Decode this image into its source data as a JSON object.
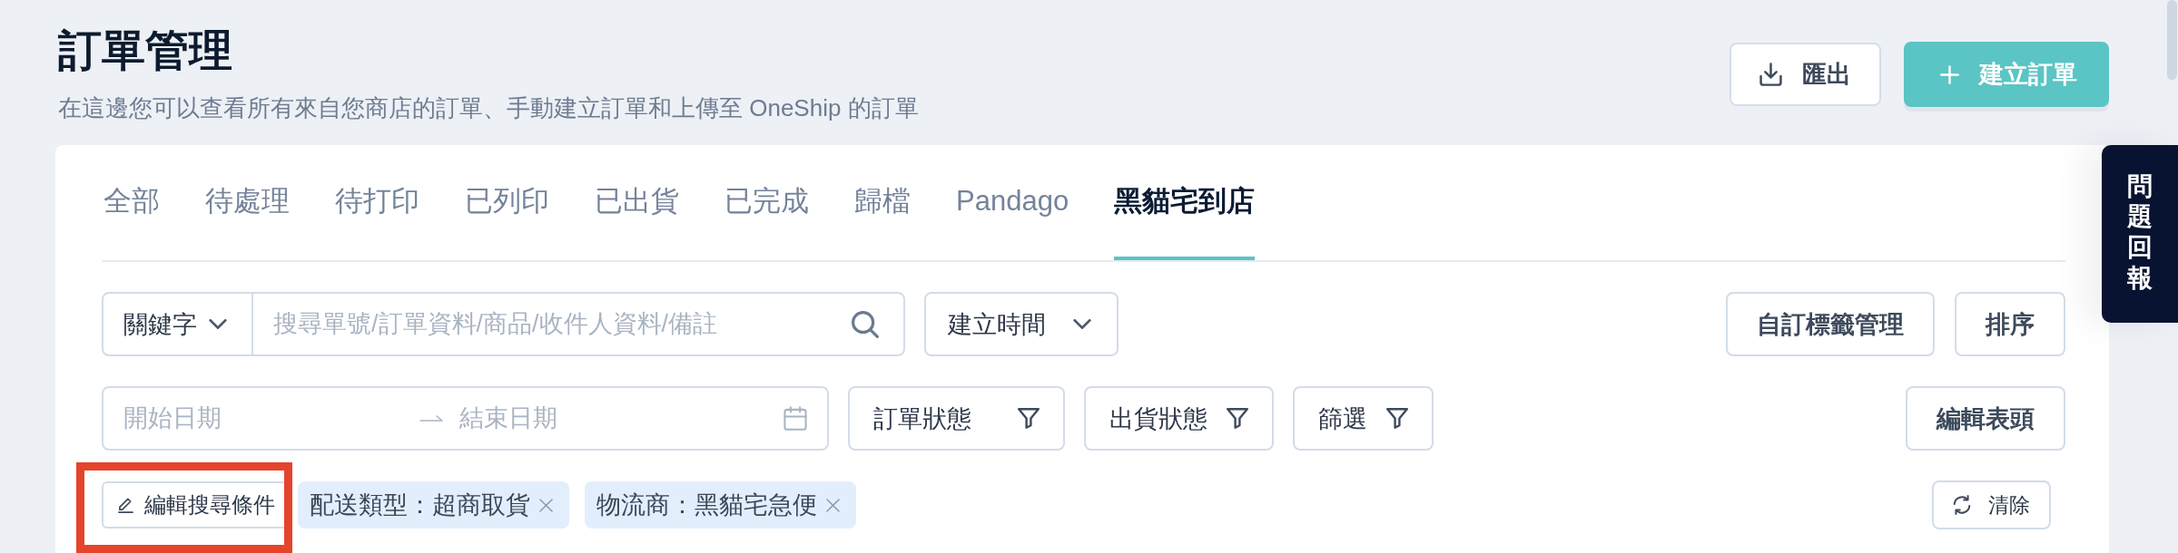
{
  "page": {
    "title": "訂單管理",
    "subtitle": "在這邊您可以查看所有來自您商店的訂單、手動建立訂單和上傳至 OneShip 的訂單"
  },
  "header_actions": [
    {
      "kind": "secondary",
      "label": "匯出"
    },
    {
      "kind": "primary",
      "label": "建立訂單"
    }
  ],
  "feedback_tab": {
    "label": "問題回報"
  },
  "tabs": [
    {
      "label": "全部",
      "selected": false
    },
    {
      "label": "待處理",
      "selected": false
    },
    {
      "label": "待打印",
      "selected": false
    },
    {
      "label": "已列印",
      "selected": false
    },
    {
      "label": "已出貨",
      "selected": false
    },
    {
      "label": "已完成",
      "selected": false
    },
    {
      "label": "歸檔",
      "selected": false
    },
    {
      "label": "Pandago",
      "selected": false
    },
    {
      "label": "黑貓宅到店",
      "selected": true
    }
  ],
  "search": {
    "field_select": "關鍵字",
    "placeholder": "搜尋單號/訂單資料/商品/收件人資料/備註"
  },
  "time_select": "建立時間",
  "toolbar_buttons": [
    "自訂標籤管理",
    "排序"
  ],
  "date_range": {
    "start_placeholder": "開始日期",
    "end_placeholder": "結束日期"
  },
  "filters": [
    "訂單狀態",
    "出貨狀態",
    "篩選"
  ],
  "edit_columns_button": "編輯表頭",
  "edit_conditions_button": "編輯搜尋條件",
  "chips": [
    {
      "label": "配送類型：超商取貨"
    },
    {
      "label": "物流商：黑貓宅急便"
    }
  ],
  "clear_button": "清除"
}
